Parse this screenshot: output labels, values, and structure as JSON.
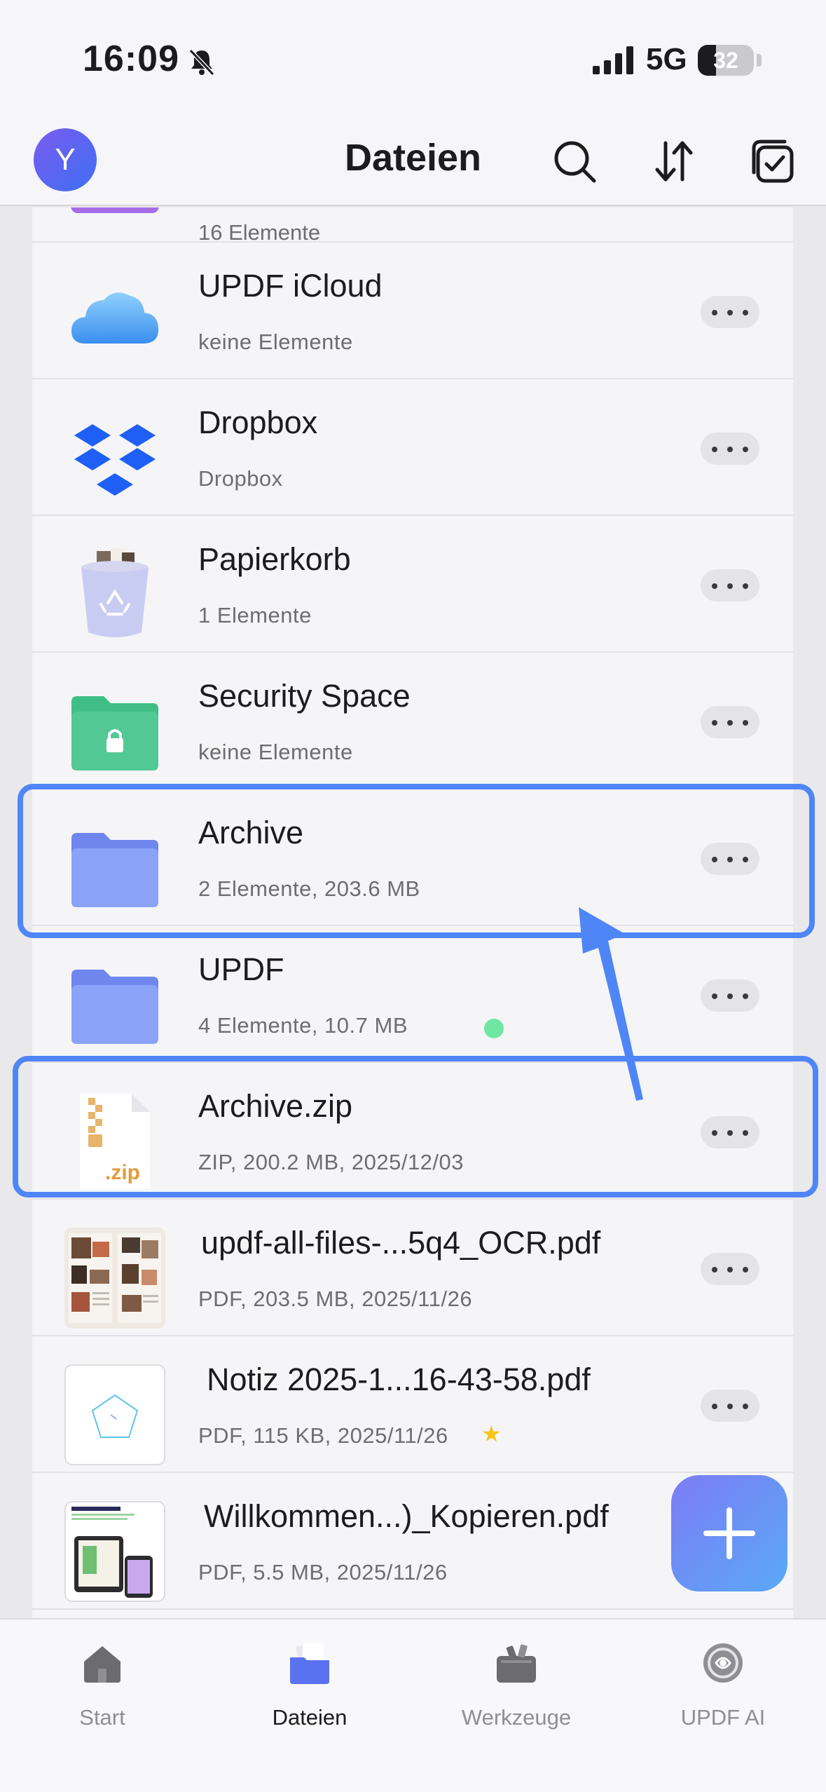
{
  "status_bar": {
    "time": "16:09",
    "network": "5G",
    "battery": "32",
    "battery_level": 0.32
  },
  "header": {
    "avatar_letter": "Y",
    "title": "Dateien",
    "icons": [
      "search-icon",
      "sort-icon",
      "select-icon"
    ]
  },
  "list": {
    "partial_item_meta": "16 Elemente",
    "items": [
      {
        "name": "UPDF iCloud",
        "meta": "keine Elemente",
        "icon": "icloud-icon"
      },
      {
        "name": "Dropbox",
        "meta": "Dropbox",
        "icon": "dropbox-icon"
      },
      {
        "name": "Papierkorb",
        "meta": "1 Elemente",
        "icon": "trash-icon"
      },
      {
        "name": "Security Space",
        "meta": "keine Elemente",
        "icon": "secure-folder-icon"
      },
      {
        "name": "Archive",
        "meta": "2 Elemente, 203.6 MB",
        "icon": "folder-icon"
      },
      {
        "name": "UPDF",
        "meta": "4 Elemente, 10.7 MB",
        "icon": "folder-icon"
      },
      {
        "name": "Archive.zip",
        "meta": "ZIP, 200.2 MB, 2025/12/03",
        "icon": "zip-file-icon",
        "badge": ".zip"
      },
      {
        "name": "updf-all-files-...5q4_OCR.pdf",
        "meta": "PDF, 203.5 MB, 2025/11/26",
        "icon": "pdf-thumbnail"
      },
      {
        "name": "Notiz 2025-1...16-43-58.pdf",
        "meta": "PDF, 115 KB, 2025/11/26",
        "icon": "pdf-thumbnail"
      },
      {
        "name": "Willkommen...)_Kopieren.pdf",
        "meta": "PDF, 5.5 MB, 2025/11/26",
        "icon": "pdf-thumbnail"
      }
    ]
  },
  "tabs": [
    {
      "label": "Start",
      "icon": "home-icon"
    },
    {
      "label": "Dateien",
      "icon": "files-icon"
    },
    {
      "label": "Werkzeuge",
      "icon": "tools-icon"
    },
    {
      "label": "UPDF AI",
      "icon": "ai-icon"
    }
  ],
  "colors": {
    "accent": "#4f86f7",
    "folder": "#7f9cf5",
    "secure_folder": "#3fbf86",
    "text_secondary": "#6d6d72"
  }
}
